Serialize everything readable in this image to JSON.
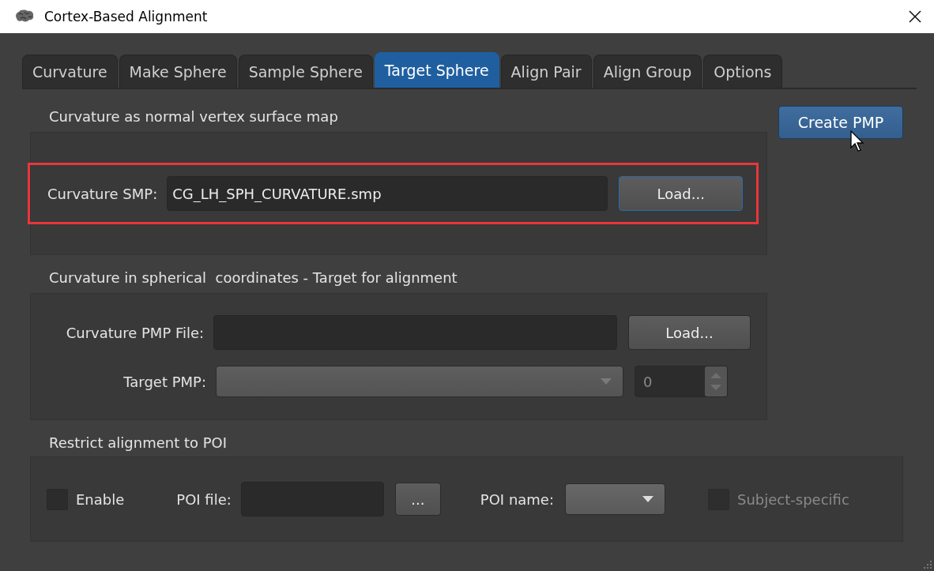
{
  "window": {
    "title": "Cortex-Based Alignment"
  },
  "tabs": [
    {
      "label": "Curvature",
      "selected": false
    },
    {
      "label": "Make Sphere",
      "selected": false
    },
    {
      "label": "Sample Sphere",
      "selected": false
    },
    {
      "label": "Target Sphere",
      "selected": true
    },
    {
      "label": "Align Pair",
      "selected": false
    },
    {
      "label": "Align Group",
      "selected": false
    },
    {
      "label": "Options",
      "selected": false
    }
  ],
  "create_button": "Create PMP",
  "groups": [
    {
      "title": "Curvature as normal vertex surface map",
      "rows": [
        {
          "kind": "file",
          "label": "Curvature SMP:",
          "value": "CG_LH_SPH_CURVATURE.smp",
          "button": "Load...",
          "highlighted": true
        }
      ]
    },
    {
      "title": "Curvature in spherical  coordinates - Target for alignment",
      "rows": [
        {
          "kind": "file",
          "label": "Curvature PMP File:",
          "button": "Load...",
          "highlighted": false
        },
        {
          "kind": "combo",
          "label": "Target PMP:",
          "disabled": true,
          "spin_value": "0"
        }
      ]
    }
  ],
  "poi_group": {
    "title": "Restrict alignment to POI",
    "enable": {
      "label": "Enable",
      "checked": false,
      "disabled": false
    },
    "file_label": "POI file:",
    "browse_button": "...",
    "name_label": "POI name:",
    "subject": {
      "label": "Subject-specific",
      "checked": false,
      "disabled": true
    }
  }
}
